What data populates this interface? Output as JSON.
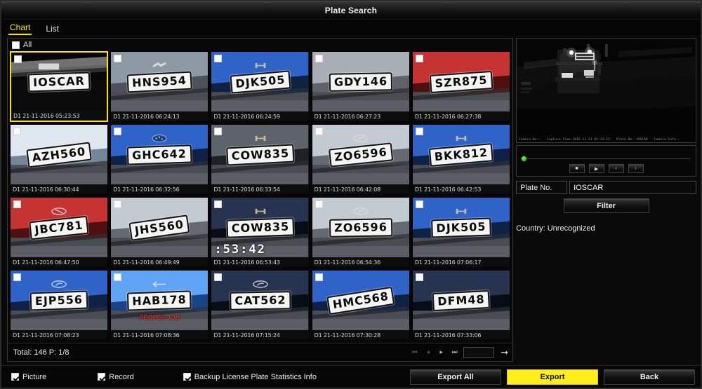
{
  "window": {
    "title": "Plate Search"
  },
  "tabs": [
    {
      "label": "Chart",
      "active": true
    },
    {
      "label": "List",
      "active": false
    }
  ],
  "grid": {
    "all_label": "All",
    "items": [
      {
        "plate": "IOSCAR",
        "stamp": "D1 21-11-2016 05:23:53",
        "selected": true,
        "scene": "night",
        "rot": -2,
        "logo": "none"
      },
      {
        "plate": "HNS954",
        "stamp": "D1 21-11-2016 06:24:13",
        "selected": false,
        "scene": "silver-sky",
        "rot": -3,
        "logo": "suzuki"
      },
      {
        "plate": "DJK505",
        "stamp": "D1 21-11-2016 06:24:59",
        "selected": false,
        "scene": "blue-car",
        "rot": -5,
        "logo": "honda"
      },
      {
        "plate": "GDY146",
        "stamp": "D1 21-11-2016 06:27:23",
        "selected": false,
        "scene": "grey-car",
        "rot": -1,
        "logo": "none"
      },
      {
        "plate": "SZR875",
        "stamp": "D1 21-11-2016 06:27:38",
        "selected": false,
        "scene": "red-car",
        "rot": -4,
        "logo": "none"
      },
      {
        "plate": "AZH560",
        "stamp": "D1 21-11-2016 06:30:44",
        "selected": false,
        "scene": "white-car",
        "rot": -7,
        "logo": "none"
      },
      {
        "plate": "GHC642",
        "stamp": "D1 21-11-2016 06:32:56",
        "selected": false,
        "scene": "blue-car",
        "rot": -2,
        "logo": "subaru"
      },
      {
        "plate": "COW835",
        "stamp": "D1 21-11-2016 06:33:54",
        "selected": false,
        "scene": "dark-grey",
        "rot": -3,
        "logo": "honda"
      },
      {
        "plate": "ZO6596",
        "stamp": "D1 21-11-2016 06:42:08",
        "selected": false,
        "scene": "silver-car",
        "rot": -6,
        "logo": "hyundai"
      },
      {
        "plate": "BKK812",
        "stamp": "D1 21-11-2016 06:42:53",
        "selected": false,
        "scene": "blue-car",
        "rot": -5,
        "logo": "honda"
      },
      {
        "plate": "JBC781",
        "stamp": "D1 21-11-2016 06:47:50",
        "selected": false,
        "scene": "red-car",
        "rot": -6,
        "logo": "lexus"
      },
      {
        "plate": "JHS560",
        "stamp": "D1 21-11-2016 06:49:49",
        "selected": false,
        "scene": "silver-car",
        "rot": -8,
        "logo": "none"
      },
      {
        "plate": "COW835",
        "stamp": "D1 21-11-2016 06:53:43",
        "selected": false,
        "scene": "dark-navy",
        "rot": -2,
        "logo": "honda",
        "overlay_time": ":53:42"
      },
      {
        "plate": "ZO6596",
        "stamp": "D1 21-11-2016 06:54:36",
        "selected": false,
        "scene": "silver-car",
        "rot": -1,
        "logo": "hyundai"
      },
      {
        "plate": "DJK505",
        "stamp": "D1 21-11-2016 07:06:17",
        "selected": false,
        "scene": "blue-car",
        "rot": -2,
        "logo": "honda"
      },
      {
        "plate": "EJP556",
        "stamp": "D1 21-11-2016 07:08:23",
        "selected": false,
        "scene": "blue-car",
        "rot": -2,
        "logo": "hyundai"
      },
      {
        "plate": "HAB178",
        "stamp": "D1 21-11-2016 07:08:36",
        "selected": false,
        "scene": "bright-blue",
        "rot": -2,
        "logo": "arrow",
        "red_text": "PEOPLE JOB"
      },
      {
        "plate": "CAT562",
        "stamp": "D1 21-11-2016 07:15:24",
        "selected": false,
        "scene": "dark-navy",
        "rot": -1,
        "logo": "hyundai"
      },
      {
        "plate": "HMC568",
        "stamp": "D1 21-11-2016 07:30:28",
        "selected": false,
        "scene": "blue-car",
        "rot": -9,
        "logo": "none"
      },
      {
        "plate": "DFM48",
        "stamp": "D1 21-11-2016 07:33:06",
        "selected": false,
        "scene": "dark-navy",
        "rot": -3,
        "logo": "none"
      }
    ]
  },
  "pager": {
    "total_text": "Total: 146  P: 1/8",
    "first_icon": "first-page-icon",
    "prev_icon": "prev-page-icon",
    "next_icon": "next-page-icon",
    "last_icon": "last-page-icon",
    "page_value": "",
    "go_icon": "go-arrow-icon"
  },
  "preview": {
    "osd": {
      "camera_no": "Camera No.:",
      "capture_time": "Capture Time:2016-11-21 05:23:52",
      "plate_no": "Plate No.:IOSCAR",
      "camera_info": "Camera Info.:"
    },
    "transport": {
      "stop_label": "■",
      "play_label": "▶",
      "prev_label": "‹",
      "next_label": "›"
    }
  },
  "filter": {
    "plate_label": "Plate No.",
    "plate_value": "IOSCAR",
    "plate_placeholder": "",
    "filter_label": "Filter",
    "country_text": "Country: Unrecognized"
  },
  "bottom": {
    "picture_label": "Picture",
    "picture_checked": true,
    "record_label": "Record",
    "record_checked": true,
    "backup_label": "Backup License Plate Statistics Info",
    "backup_checked": true,
    "export_all_label": "Export All",
    "export_label": "Export",
    "back_label": "Back"
  },
  "colors": {
    "accent": "#ffe400",
    "highlight": "#ffee1a",
    "background": "#0a0a0a"
  }
}
